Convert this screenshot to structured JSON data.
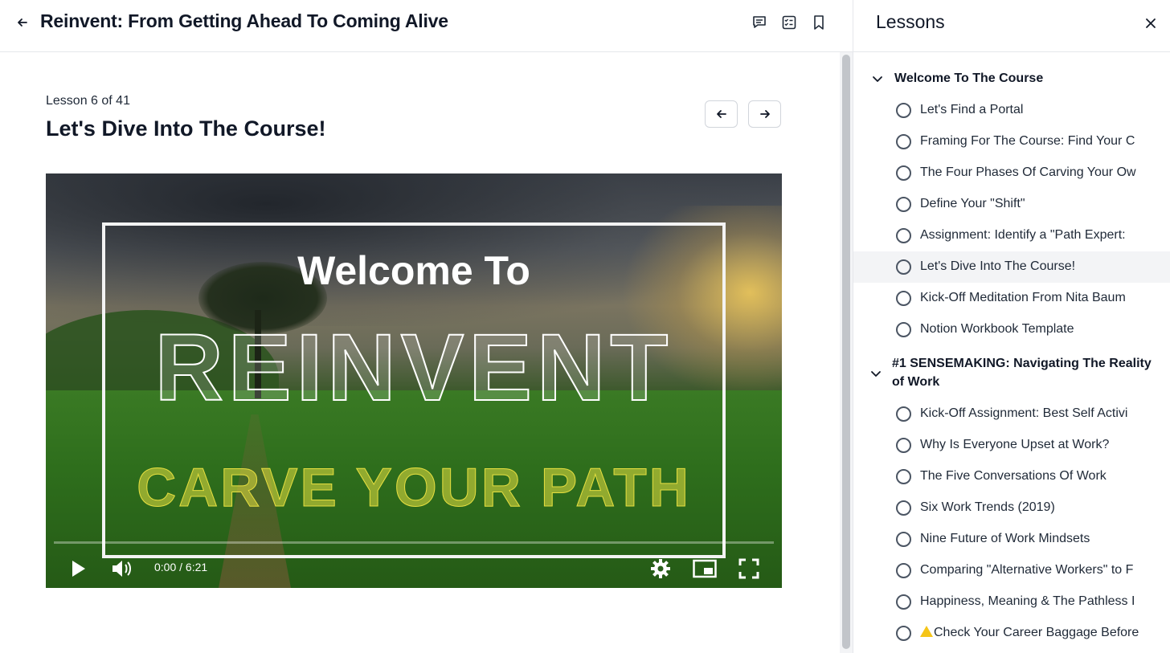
{
  "header": {
    "course_title": "Reinvent: From Getting Ahead To Coming Alive",
    "icons": [
      "arrow-left-icon",
      "comment-icon",
      "checklist-icon",
      "bookmark-icon"
    ]
  },
  "lesson": {
    "counter": "Lesson 6 of 41",
    "title": "Let's Dive Into The Course!"
  },
  "video": {
    "title_line1": "Welcome To",
    "title_line2": "REINVENT",
    "title_line3": "CARVE YOUR PATH",
    "time": "0:00 / 6:21",
    "progress": 0,
    "controls": [
      "play-icon",
      "volume-icon",
      "settings-icon",
      "miniplayer-icon",
      "fullscreen-icon"
    ]
  },
  "sidebar": {
    "title": "Lessons",
    "sections": [
      {
        "label": "Welcome To The Course",
        "lessons": [
          "Let's Find a Portal",
          "Framing For The Course: Find Your C",
          "The Four Phases Of Carving Your Ow",
          "Define Your \"Shift\"",
          "Assignment: Identify a \"Path Expert:",
          "Let's Dive Into The Course!",
          "Kick-Off Meditation From Nita Baum",
          "Notion Workbook Template"
        ]
      },
      {
        "label": "#1 SENSEMAKING: Navigating The Reality of Work",
        "lessons": [
          "Kick-Off Assignment: Best Self Activi",
          "Why Is Everyone Upset at Work?",
          "The Five Conversations Of Work",
          "Six Work Trends (2019)",
          "Nine Future of Work Mindsets",
          "Comparing \"Alternative Workers\" to F",
          "Happiness, Meaning & The Pathless I",
          "Check Your Career Baggage Before"
        ]
      }
    ],
    "active_lesson": "Let's Dive Into The Course!"
  },
  "colors": {
    "text": "#111827",
    "border": "#e5e7eb",
    "active_bg": "#f3f4f6",
    "video_title_yellow": "#e6df40"
  }
}
